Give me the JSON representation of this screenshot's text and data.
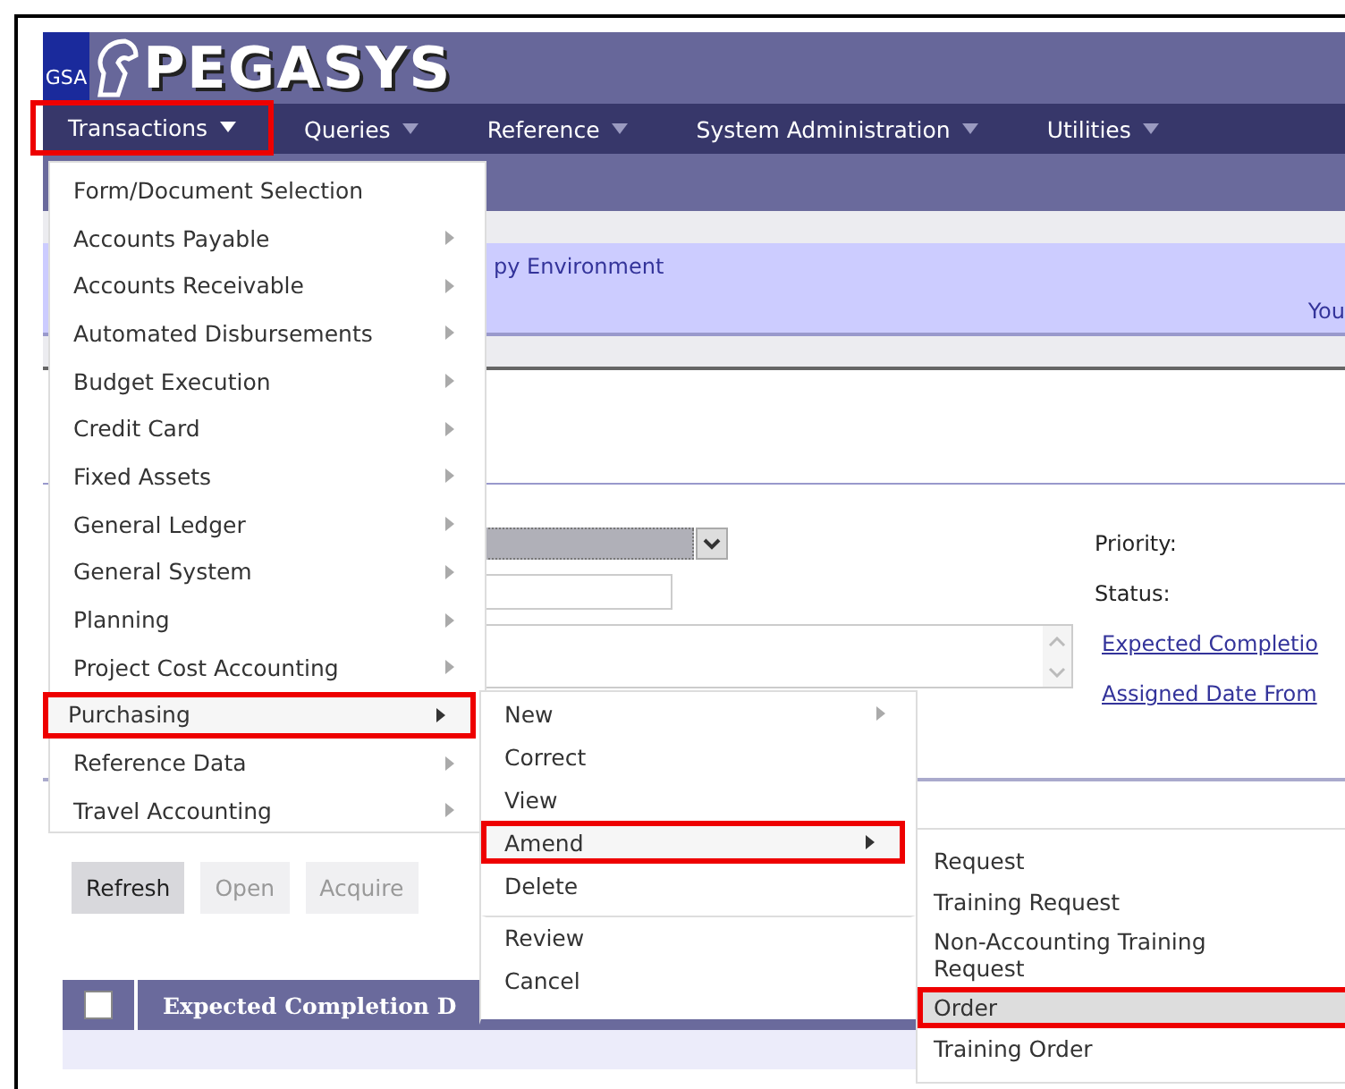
{
  "logo": {
    "badge": "GSA",
    "title": "PEGASYS"
  },
  "menu_bar": [
    {
      "label": "Transactions",
      "selected": true
    },
    {
      "label": "Queries",
      "selected": false
    },
    {
      "label": "Reference",
      "selected": false
    },
    {
      "label": "System Administration",
      "selected": false
    },
    {
      "label": "Utilities",
      "selected": false
    }
  ],
  "environment_banner": {
    "text": "py Environment",
    "user_text": "You"
  },
  "form": {
    "labels": [
      "Priority:",
      "Status:"
    ],
    "links": [
      "Expected Completio",
      "Assigned Date From"
    ]
  },
  "toolbar": [
    {
      "label": "Refresh",
      "disabled": false
    },
    {
      "label": "Open",
      "disabled": true
    },
    {
      "label": "Acquire",
      "disabled": true
    }
  ],
  "table": {
    "select_all_checked": false,
    "columns": [
      "Expected Completion D"
    ]
  },
  "transactions_menu": [
    {
      "label": "Form/Document Selection",
      "has_submenu": false,
      "selected": false
    },
    {
      "label": "Accounts Payable",
      "has_submenu": true,
      "selected": false
    },
    {
      "label": "Accounts Receivable",
      "has_submenu": true,
      "selected": false
    },
    {
      "label": "Automated Disbursements",
      "has_submenu": true,
      "selected": false
    },
    {
      "label": "Budget Execution",
      "has_submenu": true,
      "selected": false
    },
    {
      "label": "Credit Card",
      "has_submenu": true,
      "selected": false
    },
    {
      "label": "Fixed Assets",
      "has_submenu": true,
      "selected": false
    },
    {
      "label": "General Ledger",
      "has_submenu": true,
      "selected": false
    },
    {
      "label": "General System",
      "has_submenu": true,
      "selected": false
    },
    {
      "label": "Planning",
      "has_submenu": true,
      "selected": false
    },
    {
      "label": "Project Cost Accounting",
      "has_submenu": true,
      "selected": false
    },
    {
      "label": "Purchasing",
      "has_submenu": true,
      "selected": true
    },
    {
      "label": "Reference Data",
      "has_submenu": true,
      "selected": false
    },
    {
      "label": "Travel Accounting",
      "has_submenu": true,
      "selected": false
    }
  ],
  "purchasing_menu": [
    {
      "label": "New",
      "has_submenu": true,
      "selected": false,
      "separator_before": false
    },
    {
      "label": "Correct",
      "has_submenu": false,
      "selected": false,
      "separator_before": false
    },
    {
      "label": "View",
      "has_submenu": false,
      "selected": false,
      "separator_before": false
    },
    {
      "label": "Amend",
      "has_submenu": true,
      "selected": true,
      "separator_before": false
    },
    {
      "label": "Delete",
      "has_submenu": false,
      "selected": false,
      "separator_before": false
    },
    {
      "label": "Review",
      "has_submenu": false,
      "selected": false,
      "separator_before": true
    },
    {
      "label": "Cancel",
      "has_submenu": false,
      "selected": false,
      "separator_before": false
    }
  ],
  "amend_menu": [
    {
      "label": "Request",
      "selected": false
    },
    {
      "label": "Training Request",
      "selected": false
    },
    {
      "label": "Non-Accounting Training Request",
      "selected": false
    },
    {
      "label": "Order",
      "selected": true
    },
    {
      "label": "Training Order",
      "selected": false
    }
  ]
}
